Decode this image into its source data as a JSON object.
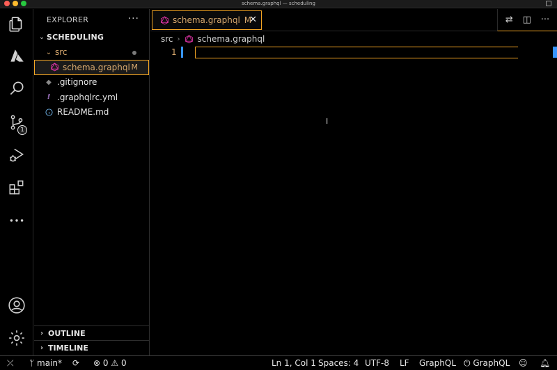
{
  "window": {
    "title": "schema.graphql — scheduling"
  },
  "activity_bar": {
    "items": [
      {
        "name": "explorer",
        "icon": "files-icon"
      },
      {
        "name": "azure",
        "icon": "azure-icon"
      },
      {
        "name": "search",
        "icon": "search-icon"
      },
      {
        "name": "source-control",
        "icon": "source-control-icon",
        "badge": "1"
      },
      {
        "name": "run-debug",
        "icon": "run-debug-icon"
      },
      {
        "name": "extensions",
        "icon": "extensions-icon"
      },
      {
        "name": "more",
        "icon": "ellipsis-icon"
      },
      {
        "name": "accounts",
        "icon": "account-icon"
      },
      {
        "name": "manage",
        "icon": "gear-icon"
      }
    ]
  },
  "sidebar": {
    "title": "EXPLORER",
    "more": "···",
    "root": "SCHEDULING",
    "folder": "src",
    "files": [
      {
        "name": "schema.graphql",
        "status": "M"
      },
      {
        "name": ".gitignore"
      },
      {
        "name": ".graphqlrc.yml"
      },
      {
        "name": "README.md"
      }
    ],
    "outline": "OUTLINE",
    "timeline": "TIMELINE"
  },
  "editor": {
    "tab": {
      "label": "schema.graphql",
      "status": "M",
      "close": "✕"
    },
    "breadcrumb": {
      "folder": "src",
      "file": "schema.graphql"
    },
    "line_number": "1"
  },
  "status_bar": {
    "branch": "main*",
    "errors": "0",
    "warnings": "0",
    "position": "Ln 1, Col 1",
    "spaces": "Spaces: 4",
    "encoding": "UTF-8",
    "eol": "LF",
    "language": "GraphQL",
    "graphql_status": "GraphQL"
  },
  "colors": {
    "accent_orange": "#f5a623",
    "modified": "#d7a86e",
    "graphql_pink": "#e535ab",
    "cursor_blue": "#3794ff"
  }
}
